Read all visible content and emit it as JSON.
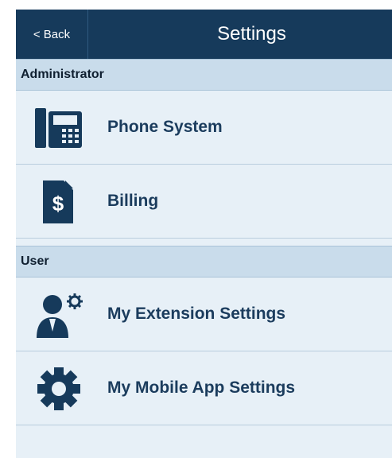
{
  "header": {
    "back_label": "< Back",
    "title": "Settings"
  },
  "sections": {
    "administrator": {
      "label": "Administrator",
      "items": [
        {
          "label": "Phone System",
          "icon": "desk-phone-icon"
        },
        {
          "label": "Billing",
          "icon": "billing-document-icon"
        }
      ]
    },
    "user": {
      "label": "User",
      "items": [
        {
          "label": "My Extension Settings",
          "icon": "user-settings-icon"
        },
        {
          "label": "My Mobile App Settings",
          "icon": "gear-icon"
        }
      ]
    }
  },
  "colors": {
    "topbar": "#163a5b",
    "accent": "#1b3c5d",
    "section": "#c9dceb",
    "background": "#e7f0f7"
  }
}
